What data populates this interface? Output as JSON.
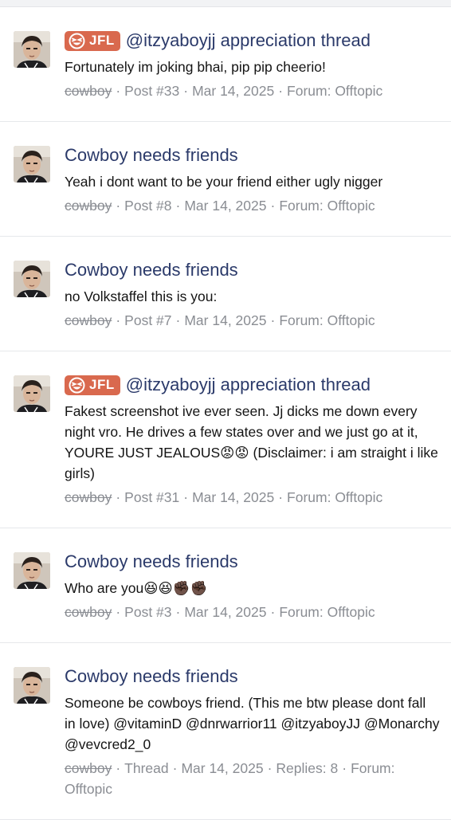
{
  "posts": [
    {
      "badge": "JFL",
      "title": "@itzyaboyjj appreciation thread",
      "body": "Fortunately im joking bhai, pip pip cheerio!",
      "user": "cowboy",
      "type": "Post #33",
      "date": "Mar 14, 2025",
      "forum": "Forum: Offtopic"
    },
    {
      "badge": "",
      "title": "Cowboy needs friends",
      "body": "Yeah i dont want to be your friend either ugly nigger",
      "user": "cowboy",
      "type": "Post #8",
      "date": "Mar 14, 2025",
      "forum": "Forum: Offtopic"
    },
    {
      "badge": "",
      "title": "Cowboy needs friends",
      "body": "no Volkstaffel this is you:",
      "user": "cowboy",
      "type": "Post #7",
      "date": "Mar 14, 2025",
      "forum": "Forum: Offtopic"
    },
    {
      "badge": "JFL",
      "title": "@itzyaboyjj appreciation thread",
      "body": "Fakest screenshot ive ever seen. Jj dicks me down every night vro. He drives a few states over and we just go at it, YOURE JUST JEALOUS😡😡 (Disclaimer: i am straight i like girls)",
      "user": "cowboy",
      "type": "Post #31",
      "date": "Mar 14, 2025",
      "forum": "Forum: Offtopic"
    },
    {
      "badge": "",
      "title": "Cowboy needs friends",
      "body": "Who are you😆😆✊🏿✊🏿",
      "user": "cowboy",
      "type": "Post #3",
      "date": "Mar 14, 2025",
      "forum": "Forum: Offtopic"
    },
    {
      "badge": "",
      "title": "Cowboy needs friends",
      "body": "Someone be cowboys friend. (This me btw please dont fall in love) @vitaminD @dnrwarrior11 @itzyaboyJJ @Monarchy @vevcred2_0",
      "user": "cowboy",
      "type": "Thread",
      "date": "Mar 14, 2025",
      "replies": "Replies: 8",
      "forum": "Forum: Offtopic"
    }
  ]
}
